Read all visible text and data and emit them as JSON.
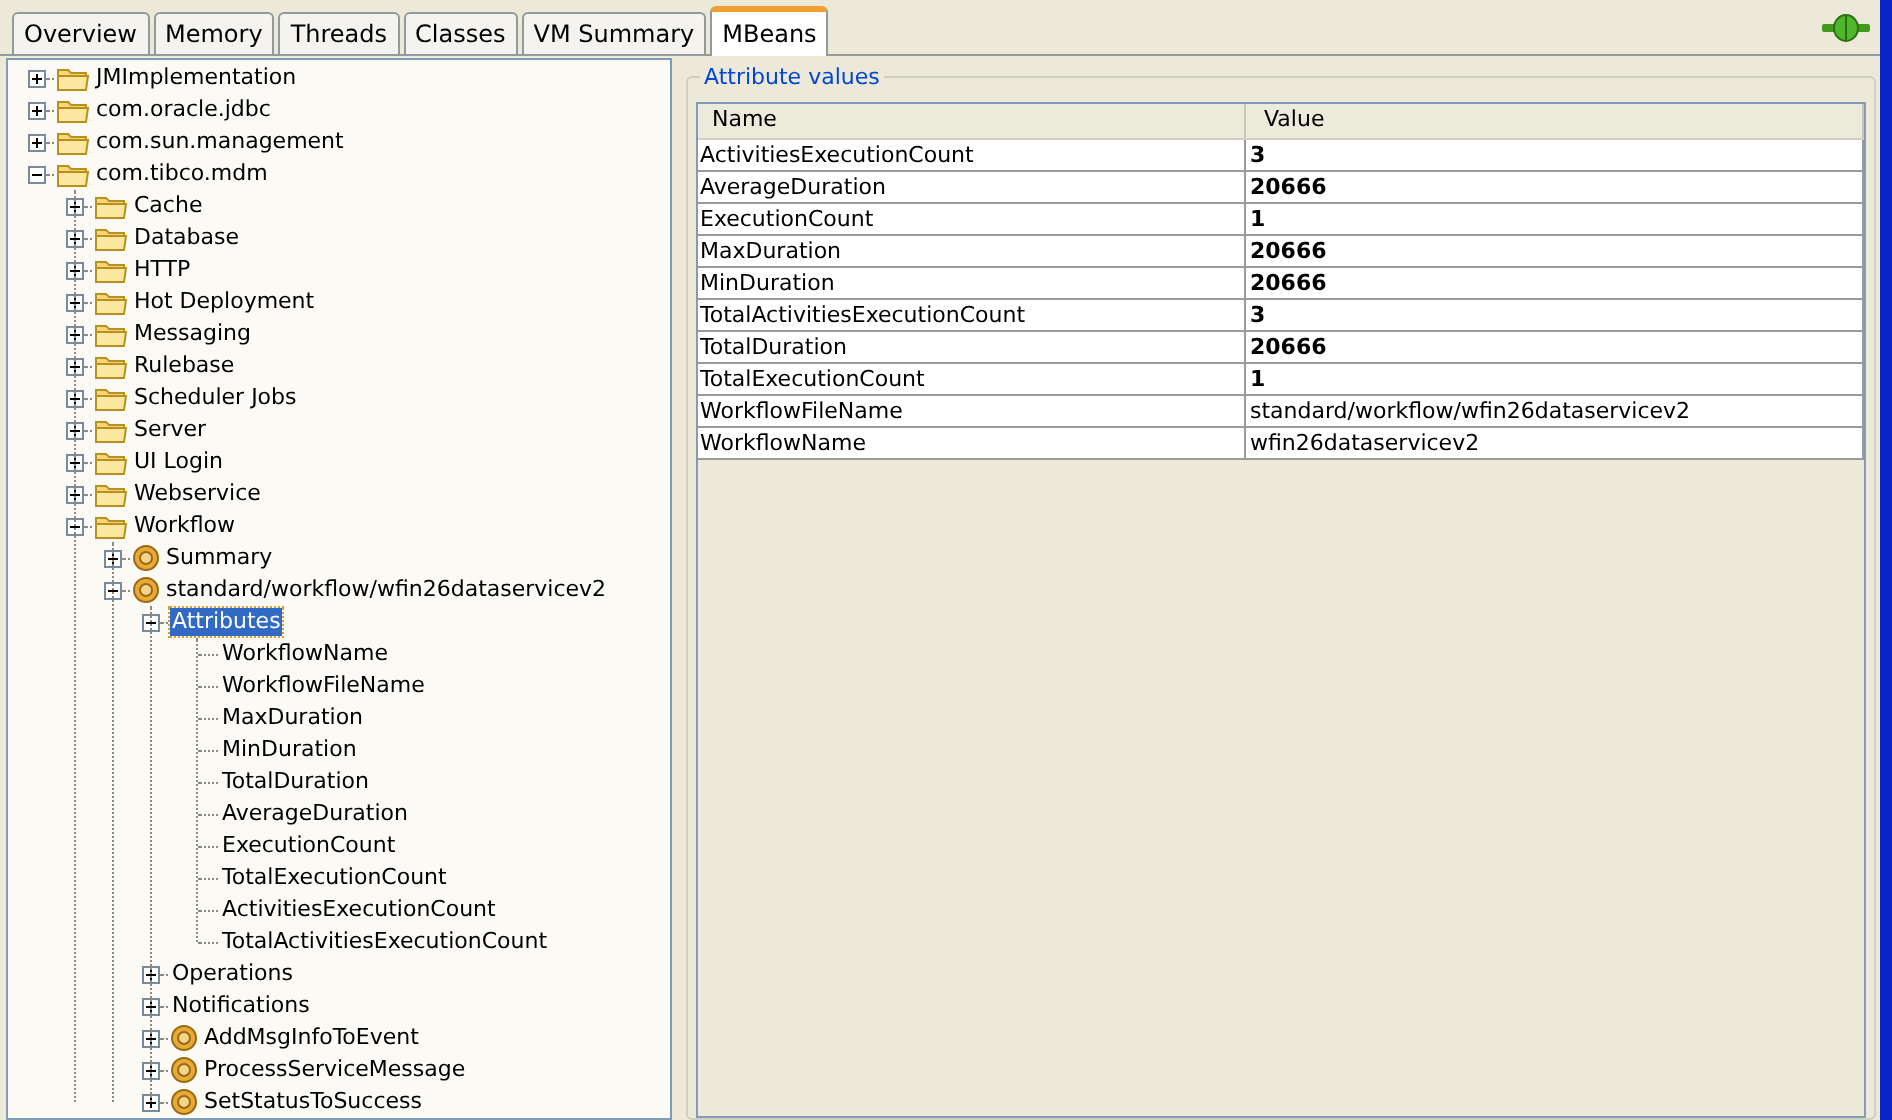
{
  "tabs": [
    {
      "label": "Overview",
      "selected": false
    },
    {
      "label": "Memory",
      "selected": false
    },
    {
      "label": "Threads",
      "selected": false
    },
    {
      "label": "Classes",
      "selected": false
    },
    {
      "label": "VM Summary",
      "selected": false
    },
    {
      "label": "MBeans",
      "selected": true
    }
  ],
  "tree": [
    {
      "label": "JMImplementation",
      "kind": "folder",
      "expanded": false
    },
    {
      "label": "com.oracle.jdbc",
      "kind": "folder",
      "expanded": false
    },
    {
      "label": "com.sun.management",
      "kind": "folder",
      "expanded": false
    },
    {
      "label": "com.tibco.mdm",
      "kind": "folder",
      "expanded": true,
      "children": [
        {
          "label": "Cache",
          "kind": "folder",
          "expanded": false
        },
        {
          "label": "Database",
          "kind": "folder",
          "expanded": false
        },
        {
          "label": "HTTP",
          "kind": "folder",
          "expanded": false
        },
        {
          "label": "Hot Deployment",
          "kind": "folder",
          "expanded": false
        },
        {
          "label": "Messaging",
          "kind": "folder",
          "expanded": false
        },
        {
          "label": "Rulebase",
          "kind": "folder",
          "expanded": false
        },
        {
          "label": "Scheduler Jobs",
          "kind": "folder",
          "expanded": false
        },
        {
          "label": "Server",
          "kind": "folder",
          "expanded": false
        },
        {
          "label": "UI Login",
          "kind": "folder",
          "expanded": false
        },
        {
          "label": "Webservice",
          "kind": "folder",
          "expanded": false
        },
        {
          "label": "Workflow",
          "kind": "folder",
          "expanded": true,
          "children": [
            {
              "label": "Summary",
              "kind": "bean",
              "expanded": false
            },
            {
              "label": "standard/workflow/wfin26dataservicev2",
              "kind": "bean",
              "expanded": true,
              "children": [
                {
                  "label": "Attributes",
                  "kind": "plain",
                  "expanded": true,
                  "selected": true,
                  "children": [
                    {
                      "label": "WorkflowName",
                      "kind": "leaf",
                      "selected": false
                    },
                    {
                      "label": "WorkflowFileName",
                      "kind": "leaf",
                      "selected": false
                    },
                    {
                      "label": "MaxDuration",
                      "kind": "leaf",
                      "selected": false
                    },
                    {
                      "label": "MinDuration",
                      "kind": "leaf",
                      "selected": false
                    },
                    {
                      "label": "TotalDuration",
                      "kind": "leaf",
                      "selected": false
                    },
                    {
                      "label": "AverageDuration",
                      "kind": "leaf",
                      "selected": false
                    },
                    {
                      "label": "ExecutionCount",
                      "kind": "leaf",
                      "selected": false
                    },
                    {
                      "label": "TotalExecutionCount",
                      "kind": "leaf",
                      "selected": false
                    },
                    {
                      "label": "ActivitiesExecutionCount",
                      "kind": "leaf",
                      "selected": false
                    },
                    {
                      "label": "TotalActivitiesExecutionCount",
                      "kind": "leaf",
                      "selected": false
                    }
                  ]
                },
                {
                  "label": "Operations",
                  "kind": "plain",
                  "expanded": false,
                  "selected": false
                },
                {
                  "label": "Notifications",
                  "kind": "plain",
                  "expanded": false,
                  "selected": false
                },
                {
                  "label": "AddMsgInfoToEvent",
                  "kind": "bean",
                  "expanded": false
                },
                {
                  "label": "ProcessServiceMessage",
                  "kind": "bean",
                  "expanded": false
                },
                {
                  "label": "SetStatusToSuccess",
                  "kind": "bean",
                  "expanded": false
                }
              ]
            }
          ]
        }
      ]
    }
  ],
  "attributes": {
    "title": "Attribute values",
    "columns": [
      "Name",
      "Value"
    ],
    "rows": [
      {
        "name": "ActivitiesExecutionCount",
        "value": "3",
        "bold": true
      },
      {
        "name": "AverageDuration",
        "value": "20666",
        "bold": true
      },
      {
        "name": "ExecutionCount",
        "value": "1",
        "bold": true
      },
      {
        "name": "MaxDuration",
        "value": "20666",
        "bold": true
      },
      {
        "name": "MinDuration",
        "value": "20666",
        "bold": true
      },
      {
        "name": "TotalActivitiesExecutionCount",
        "value": "3",
        "bold": true
      },
      {
        "name": "TotalDuration",
        "value": "20666",
        "bold": true
      },
      {
        "name": "TotalExecutionCount",
        "value": "1",
        "bold": true
      },
      {
        "name": "WorkflowFileName",
        "value": "standard/workflow/wfin26dataservicev2",
        "bold": false
      },
      {
        "name": "WorkflowName",
        "value": "wfin26dataservicev2",
        "bold": false
      }
    ]
  }
}
